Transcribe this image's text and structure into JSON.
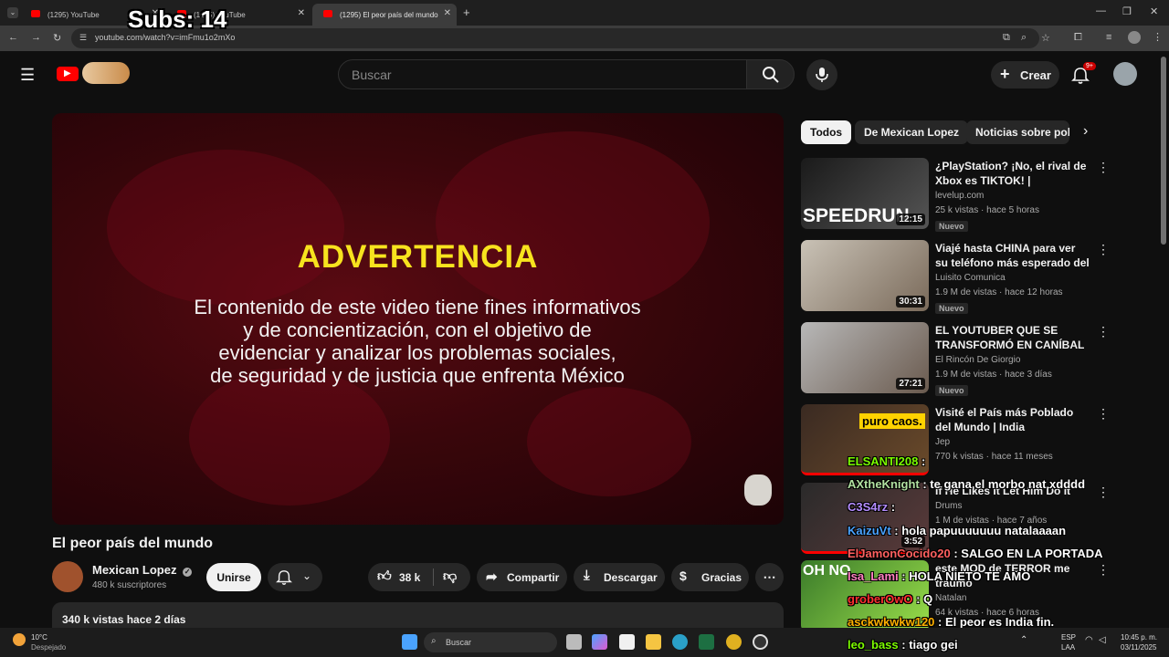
{
  "browser": {
    "tabs": [
      {
        "title": "(1295) YouTube"
      },
      {
        "title": "(1295) YouTube"
      },
      {
        "title": "(1295) El peor país del mundo"
      }
    ],
    "url": "youtube.com/watch?v=imFmu1o2mXo"
  },
  "header": {
    "search_placeholder": "Buscar",
    "create_label": "Crear",
    "notif_badge": "9+"
  },
  "player": {
    "warning_title": "ADVERTENCIA",
    "warning_lines": [
      "El contenido de este video tiene fines informativos",
      "y de concientización, con el objetivo de",
      "evidenciar y analizar los problemas sociales,",
      "de seguridad y de justicia que enfrenta México"
    ]
  },
  "video": {
    "title": "El peor país del mundo",
    "channel": "Mexican Lopez",
    "subscribers": "480 k suscriptores",
    "join_label": "Unirse",
    "likes": "38 k",
    "share_label": "Compartir",
    "download_label": "Descargar",
    "thanks_label": "Gracias",
    "views_date": "340 k vistas  hace 2 días"
  },
  "chips": [
    {
      "label": "Todos"
    },
    {
      "label": "De Mexican Lopez"
    },
    {
      "label": "Noticias sobre polí"
    }
  ],
  "recommendations": [
    {
      "title": "¿PlayStation? ¡No, el rival de Xbox es TIKTOK! | SPEEDRUN",
      "channel": "levelup.com",
      "meta": "25 k vistas · hace 5 horas",
      "duration": "12:15",
      "badge": "Nuevo",
      "thumb_text": "SPEEDRUN"
    },
    {
      "title": "Viajé hasta CHINA para ver su teléfono más esperado del añ...",
      "channel": "Luisito Comunica",
      "meta": "1.9 M de vistas · hace 12 horas",
      "duration": "30:31",
      "badge": "Nuevo"
    },
    {
      "title": "EL YOUTUBER QUE SE TRANSFORMÓ EN CANÍBAL ...",
      "channel": "El Rincón De Giorgio",
      "meta": "1.9 M de vistas · hace 3 días",
      "duration": "27:21",
      "badge": "Nuevo"
    },
    {
      "title": "Visité el País más Poblado del Mundo | India",
      "channel": "Jep",
      "meta": "770 k vistas · hace 11 meses",
      "duration": "",
      "badge": "",
      "thumb_text": "puro caos."
    },
    {
      "title": "If He Likes It Let Him Do It",
      "channel": "Drums",
      "meta": "1 M de vistas · hace 7 años",
      "duration": "3:52",
      "badge": ""
    },
    {
      "title": "este MOD de TERROR me traumó",
      "channel": "Natalan",
      "meta": "64 k vistas · hace 6 horas",
      "duration": "",
      "badge": "",
      "thumb_text": "OH NO"
    }
  ],
  "overlay": {
    "subs": "Subs: 14",
    "chat": [
      {
        "user": "ELSANTI208",
        "msg": ":",
        "color": "#7cfc00"
      },
      {
        "user": "AXtheKnight",
        "msg": ": te gana el morbo nat xdddd",
        "color": "#b0e0a0"
      },
      {
        "user": "C3S4rz",
        "msg": ":",
        "color": "#b48cff"
      },
      {
        "user": "KaizuVt",
        "msg": ": hola papuuuuuuu natalaaaan",
        "color": "#4aa3ff"
      },
      {
        "user": "ElJamonCocido20",
        "msg": ": SALGO EN LA PORTADA",
        "color": "#ff6060"
      },
      {
        "user": "Isa_Lami",
        "msg": ": HOLA NIETO TE AMO",
        "color": "#ff80c0"
      },
      {
        "user": "groberOwO",
        "msg": ": Q",
        "color": "#ff3030"
      },
      {
        "user": "asckwkwkw120",
        "msg": ": El peor es India fin.",
        "color": "#ffb000"
      },
      {
        "user": "leo_bass",
        "msg": ": tiago gei",
        "color": "#7cfc00"
      }
    ]
  },
  "taskbar": {
    "weather_temp": "10°C",
    "weather_desc": "Despejado",
    "search_label": "Buscar",
    "lang_top": "ESP",
    "lang_bottom": "LAA",
    "time": "10:45 p. m.",
    "date": "03/11/2025"
  },
  "colors": {
    "accent_red": "#ff0000",
    "warning_yellow": "#f7e31e"
  }
}
